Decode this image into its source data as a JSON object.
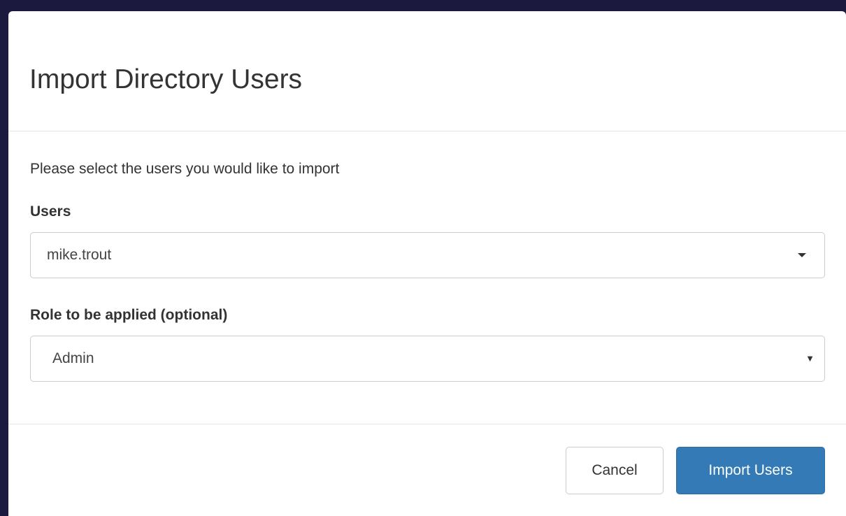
{
  "modal": {
    "title": "Import Directory Users",
    "intro": "Please select the users you would like to import"
  },
  "users_field": {
    "label": "Users",
    "selected": "mike.trout"
  },
  "role_field": {
    "label": "Role to be applied (optional)",
    "selected": "Admin",
    "caret": "▼"
  },
  "footer": {
    "cancel_label": "Cancel",
    "import_label": "Import Users"
  },
  "colors": {
    "backdrop": "#1b1a3e",
    "primary": "#337ab7",
    "border": "#cccccc",
    "divider": "#e5e5e5"
  },
  "icons": {
    "users_dropdown": "caret-down-icon",
    "role_dropdown": "chevron-down-icon"
  }
}
